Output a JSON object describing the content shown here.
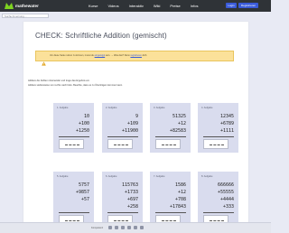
{
  "header": {
    "logo_text": "mathewater",
    "nav": [
      "Kurse",
      "Videos",
      "Interaktiv",
      "Wiki",
      "Preise",
      "Infos"
    ],
    "login_label": "Login",
    "register_label": "Registrieren"
  },
  "search": {
    "placeholder": "Suche & Lernung ..."
  },
  "page": {
    "title": "CHECK: Schriftliche Addition (gemischt)",
    "alert": {
      "pre": "Um diese Seite nutzen zu können, musst du ",
      "link1": "eingeloggt",
      "mid": " sein. → Was das? Dann ",
      "link2": "registrieren",
      "post": " dich."
    },
    "instructions": [
      "Addiere die Zahlen miteinander und trage das Ergebnis ein.",
      "Addiere stellenweise von rechts nach links. Beachte, dass es zu Überträgen kommen kann."
    ]
  },
  "tasks": [
    {
      "label": "1. Aufgabe",
      "rows": [
        "10",
        "+100",
        "+1250"
      ]
    },
    {
      "label": "2. Aufgabe",
      "rows": [
        "9",
        "+109",
        "+11900"
      ]
    },
    {
      "label": "3. Aufgabe",
      "rows": [
        "51325",
        "+12",
        "+82583"
      ]
    },
    {
      "label": "4. Aufgabe",
      "rows": [
        "12345",
        "+6789",
        "+1111"
      ]
    },
    {
      "label": "5. Aufgabe",
      "rows": [
        "5757",
        "+9857",
        "+57"
      ]
    },
    {
      "label": "6. Aufgabe",
      "rows": [
        "115763",
        "+1733",
        "+697",
        "+258"
      ]
    },
    {
      "label": "7. Aufgabe",
      "rows": [
        "1586",
        "+12",
        "+708",
        "+17843"
      ]
    },
    {
      "label": "8. Aufgabe",
      "rows": [
        "666666",
        "+55555",
        "+4444",
        "+333"
      ]
    }
  ],
  "footer": {
    "label": "Kompetenz"
  },
  "colors": {
    "topbar": "#2f3337",
    "accent": "#3a5bd9",
    "task_bg": "#d9dcee",
    "alert_bg": "#fbe19a"
  }
}
